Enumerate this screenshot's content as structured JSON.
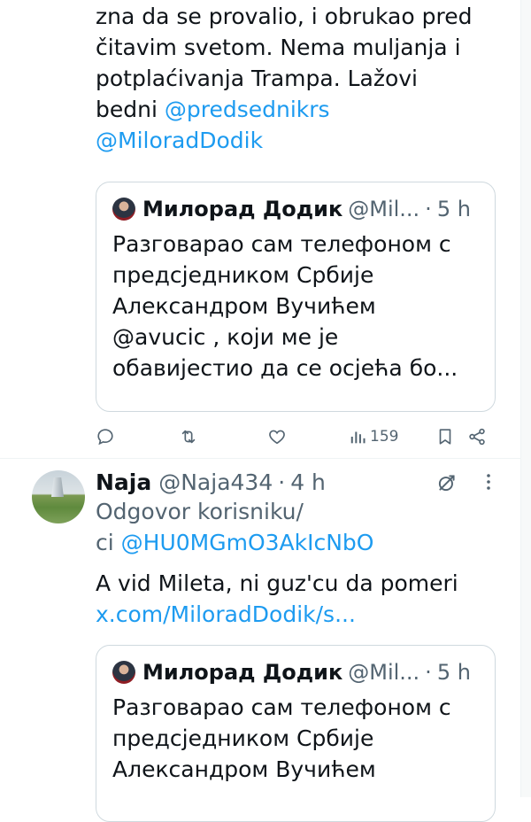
{
  "tweet1": {
    "text_lines": [
      "zna da se provalio, i obrukao pred",
      "čitavim svetom. Nema muljanja i",
      "potplaćivanja Trampa. Lažovi"
    ],
    "line4_prefix": "bedni ",
    "mention1": "@predsednikrs",
    "mention2": "@MiloradDodik",
    "quote": {
      "name": "Милорад Додик",
      "handle": "@Mil...",
      "dot": "·",
      "time": "5 h",
      "lines": [
        "Разговарао сам телефоном с",
        "предсједником Србије",
        "Александром Вучићем",
        "@avucic , који ме је",
        "обавијестио да се осјећа бо..."
      ]
    },
    "actions": {
      "views": "159",
      "icons": [
        "reply-icon",
        "retweet-icon",
        "like-icon",
        "views-icon",
        "bookmark-icon",
        "share-icon"
      ]
    }
  },
  "tweet2": {
    "name": "Naja",
    "handle": "@Naja434",
    "dot": "·",
    "time": "4 h",
    "reply_label_line1": "Odgovor korisniku/",
    "reply_label_line2_prefix": "ci ",
    "reply_to": "@HU0MGmO3AkIcNbO",
    "text": "A vid Mileta, ni guz'cu da pomeri",
    "link": "x.com/MiloradDodik/s...",
    "quote": {
      "name": "Милорад Додик",
      "handle": "@Mil...",
      "dot": "·",
      "time": "5 h",
      "lines": [
        "Разговарао сам телефоном с",
        "предсједником Србије",
        "Александром Вучићем"
      ]
    }
  },
  "colors": {
    "link": "#1d9bf0",
    "muted": "#536471",
    "text": "#0f1419",
    "border": "#cfd9de"
  }
}
